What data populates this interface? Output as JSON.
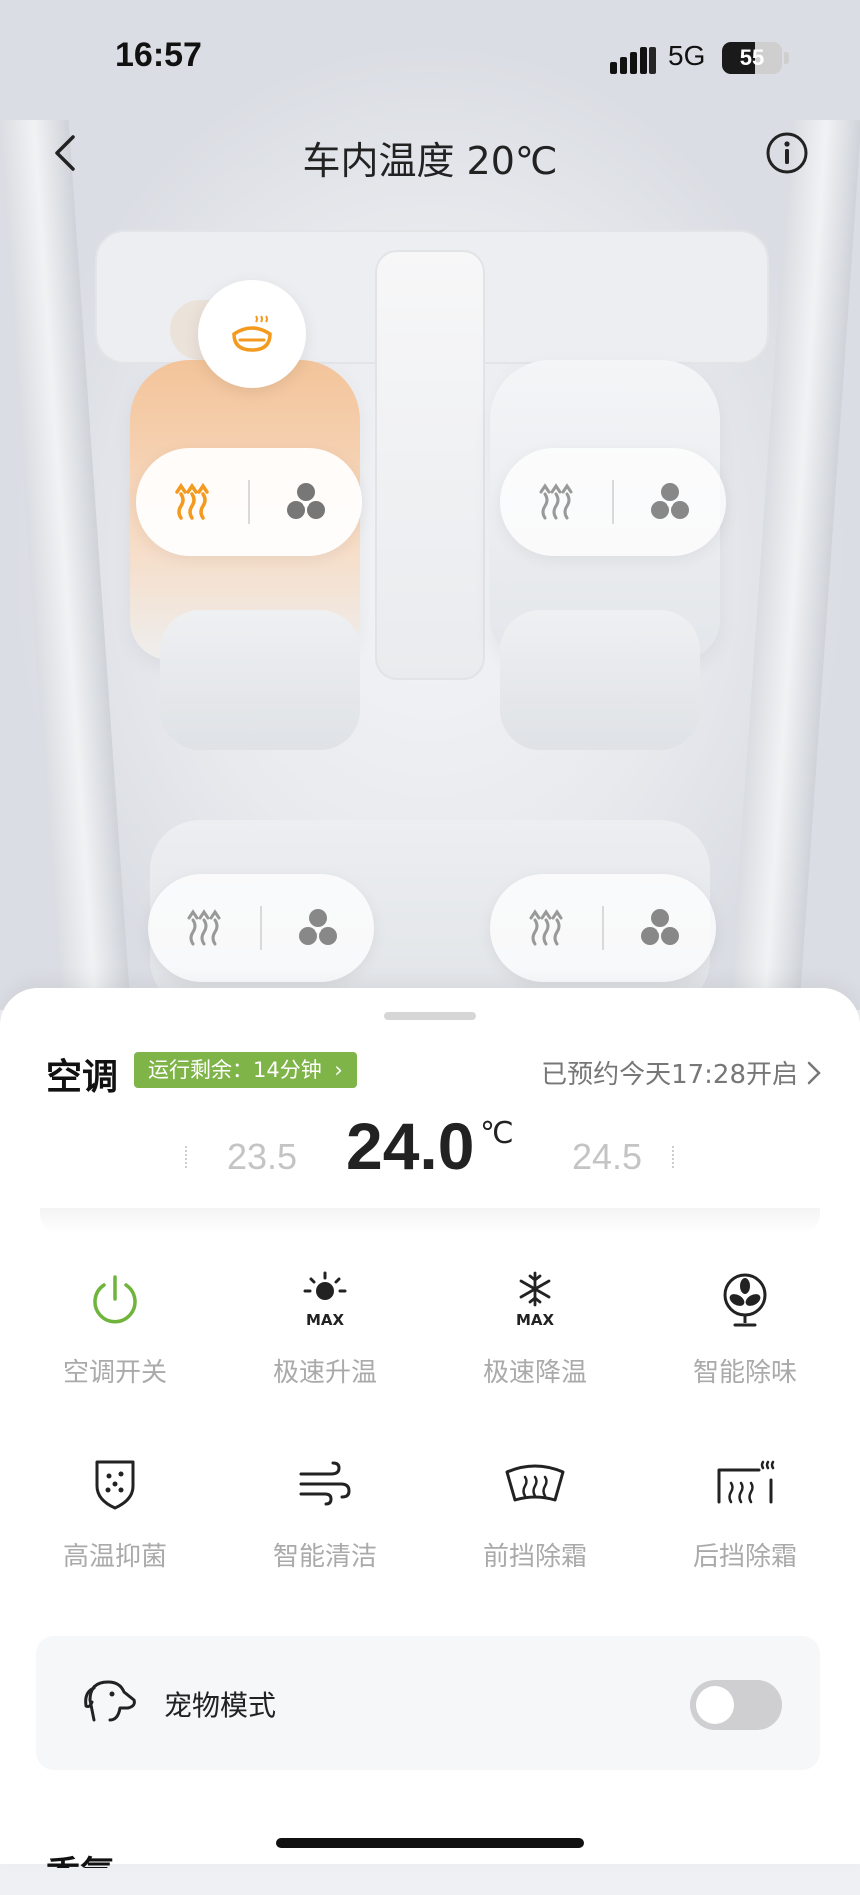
{
  "status_bar": {
    "time": "16:57",
    "network": "5G",
    "battery": "55",
    "battery_level": 0.55
  },
  "nav": {
    "title": "车内温度 20℃"
  },
  "seats": {
    "front_left": {
      "heat_active": true
    },
    "front_right": {
      "heat_active": false
    },
    "rear_left": {
      "heat_active": false
    },
    "rear_right": {
      "heat_active": false
    }
  },
  "colors": {
    "accent_orange": "#f39a1f",
    "runtime_green": "#7fb449",
    "power_green": "#6fb43b"
  },
  "ac": {
    "title": "空调",
    "runtime_label": "运行剩余：14分钟",
    "schedule_label": "已预约今天17:28开启",
    "temp_prev": "23.5",
    "temp_current": "24.0",
    "temp_unit": "℃",
    "temp_next": "24.5"
  },
  "functions": [
    {
      "label": "空调开关",
      "icon": "power-icon"
    },
    {
      "label": "极速升温",
      "icon": "sun-max-icon"
    },
    {
      "label": "极速降温",
      "icon": "snowflake-max-icon"
    },
    {
      "label": "智能除味",
      "icon": "fan-icon"
    },
    {
      "label": "高温抑菌",
      "icon": "shield-dots-icon"
    },
    {
      "label": "智能清洁",
      "icon": "wind-icon"
    },
    {
      "label": "前挡除霜",
      "icon": "front-defrost-icon"
    },
    {
      "label": "后挡除霜",
      "icon": "rear-defrost-icon"
    }
  ],
  "pet_mode": {
    "label": "宠物模式",
    "enabled": false
  },
  "next_section": {
    "title": "香氛"
  }
}
